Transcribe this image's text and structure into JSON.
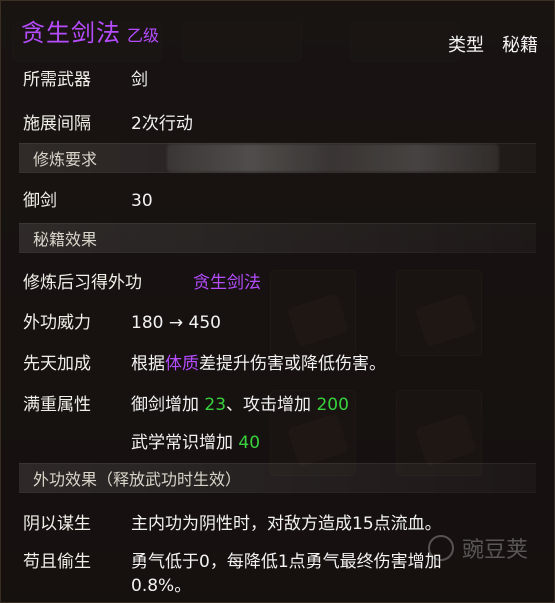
{
  "tooltip": {
    "title": "贪生剑法",
    "grade": "乙级",
    "type_label": "类型",
    "type_value": "秘籍",
    "rows": {
      "weapon": {
        "label": "所需武器",
        "value": "剑"
      },
      "interval": {
        "label": "施展间隔",
        "value": "2次行动"
      },
      "train_header": "修炼要求",
      "sword": {
        "label": "御剑",
        "value": "30"
      },
      "secret_header": "秘籍效果",
      "learn": {
        "label": "修炼后习得外功",
        "value": "贪生剑法"
      },
      "power": {
        "label": "外功威力",
        "value": "180 → 450"
      },
      "innate": {
        "label": "先天加成",
        "value_prefix": "根据",
        "value_highlight": "体质",
        "value_suffix": "差提升伤害或降低伤害。"
      },
      "maxed": {
        "label": "满重属性",
        "line1_prefix": "御剑增加 ",
        "line1_val1": "23",
        "line1_mid": "、攻击增加 ",
        "line1_val2": "200",
        "line2_prefix": "武学常识增加 ",
        "line2_val": "40"
      },
      "effects_header": "外功效果（释放武功时生效）",
      "yin": {
        "label": "阴以谋生",
        "value": "主内功为阴性时，对敌方造成15点流血。"
      },
      "gou": {
        "label": "苟且偷生",
        "value_line1": "勇气低于0，每降低1点勇气最终伤害增加",
        "value_line2": "0.8%。"
      }
    }
  },
  "watermark": {
    "text": "豌豆荚",
    "icon": "circle-logo-icon"
  }
}
